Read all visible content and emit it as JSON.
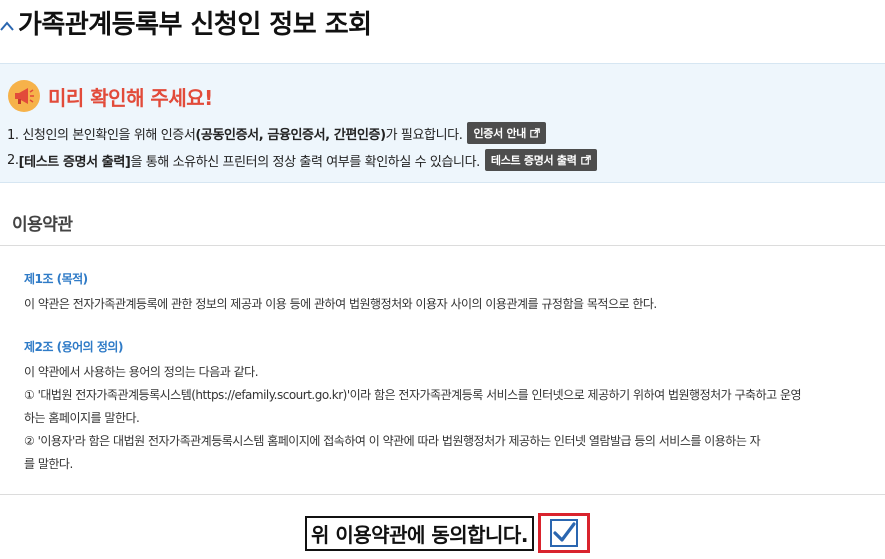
{
  "header": {
    "title": "가족관계등록부 신청인 정보 조회"
  },
  "notice": {
    "title": "미리 확인해 주세요!",
    "line1": {
      "prefix": "1. 신청인의 본인확인을 위해 인증서",
      "bold": "(공동인증서, 금융인증서, 간편인증)",
      "suffix": "가 필요합니다.",
      "button": "인증서 안내"
    },
    "line2": {
      "prefix": "2. ",
      "bold": "[테스트 증명서 출력]",
      "suffix": "을 통해 소유하신 프린터의 정상 출력 여부를 확인하실 수 있습니다.",
      "button": "테스트 증명서 출력"
    }
  },
  "terms": {
    "section_title": "이용약관",
    "article1": {
      "heading": "제1조 (목적)",
      "lines": [
        "이 약관은 전자가족관계등록에 관한 정보의 제공과 이용 등에 관하여 법원행정처와 이용자 사이의 이용관계를 규정함을 목적으로 한다."
      ]
    },
    "article2": {
      "heading": "제2조 (용어의 정의)",
      "lines": [
        "이 약관에서 사용하는 용어의 정의는 다음과 같다.",
        "① '대법원 전자가족관계등록시스템(https://efamily.scourt.go.kr)'이라 함은 전자가족관계등록 서비스를 인터넷으로 제공하기 위하여 법원행정처가 구축하고 운영",
        "하는 홈페이지를 말한다.",
        "② '이용자'라 함은 대법원 전자가족관계등록시스템 홈페이지에 접속하여 이 약관에 따라 법원행정처가 제공하는 인터넷 열람발급 등의 서비스를 이용하는 자",
        "를 말한다."
      ]
    }
  },
  "agreement": {
    "label": "위 이용약관에 동의합니다.",
    "checked": true
  },
  "colors": {
    "notice_title": "#e24b3a",
    "notice_bg": "#eef6fc",
    "term_heading": "#2f7bc7",
    "highlight_box": "#d9232d",
    "checkbox": "#2a66b0"
  },
  "icons": {
    "back": "chevron-up-icon",
    "notice": "megaphone-icon",
    "external": "external-link-icon",
    "check": "check-icon"
  }
}
